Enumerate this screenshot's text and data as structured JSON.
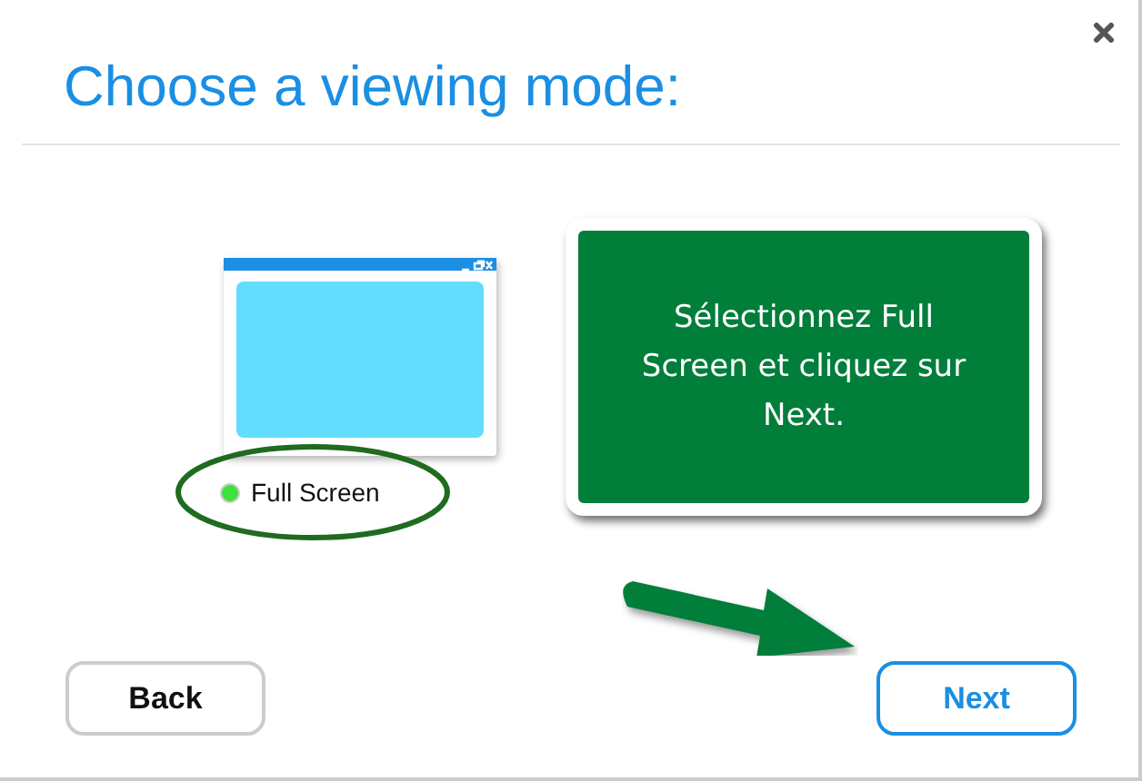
{
  "dialog": {
    "title": "Choose a viewing mode:"
  },
  "modes": [
    {
      "label": "Full Screen",
      "selected": true
    }
  ],
  "callout": {
    "text": "Sélectionnez Full Screen et cliquez sur Next."
  },
  "buttons": [
    {
      "label": "Back",
      "kind": "secondary"
    },
    {
      "label": "Next",
      "kind": "primary"
    }
  ]
}
